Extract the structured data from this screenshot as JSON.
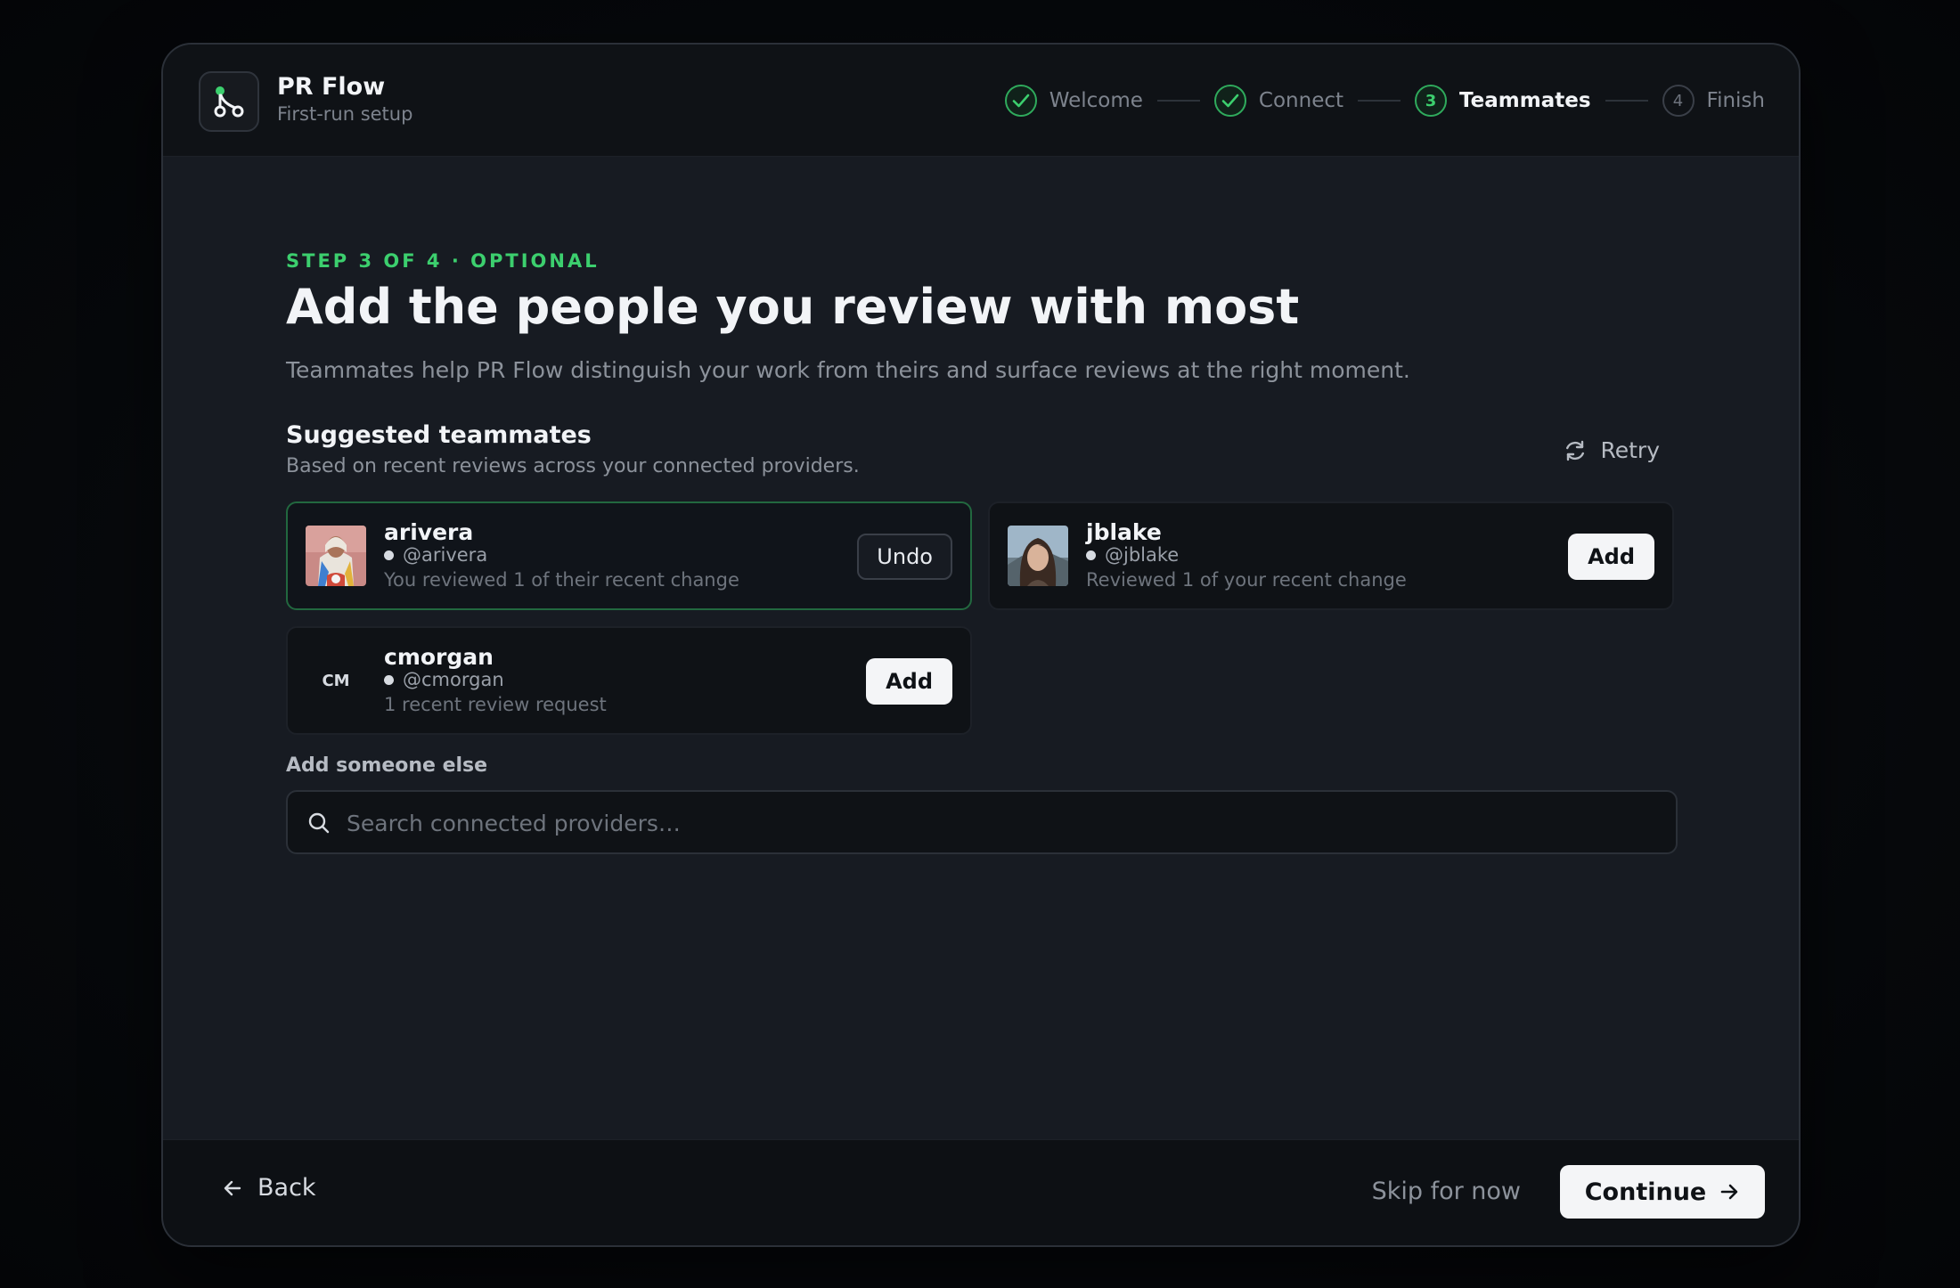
{
  "app": {
    "name": "PR Flow",
    "subtitle": "First-run setup"
  },
  "stepper": {
    "steps": [
      {
        "label": "Welcome",
        "state": "done",
        "number": "1"
      },
      {
        "label": "Connect",
        "state": "done",
        "number": "2"
      },
      {
        "label": "Teammates",
        "state": "active",
        "number": "3"
      },
      {
        "label": "Finish",
        "state": "todo",
        "number": "4"
      }
    ]
  },
  "page": {
    "eyebrow": "STEP 3 OF 4 · OPTIONAL",
    "title": "Add the people you review with most",
    "description": "Teammates help PR Flow distinguish your work from theirs and surface reviews at the right moment."
  },
  "suggested": {
    "title": "Suggested teammates",
    "subtitle": "Based on recent reviews across your connected providers.",
    "retry_label": "Retry",
    "people": [
      {
        "name": "arivera",
        "handle": "@arivera",
        "meta": "You reviewed 1 of their recent change",
        "action": "Undo",
        "selected": true,
        "avatar": "photo"
      },
      {
        "name": "jblake",
        "handle": "@jblake",
        "meta": "Reviewed 1 of your recent change",
        "action": "Add",
        "selected": false,
        "avatar": "photo"
      },
      {
        "name": "cmorgan",
        "handle": "@cmorgan",
        "meta": "1 recent review request",
        "action": "Add",
        "selected": false,
        "avatar": "initials",
        "initials": "CM"
      }
    ]
  },
  "add_other": {
    "label": "Add someone else",
    "placeholder": "Search connected providers…",
    "value": ""
  },
  "footer": {
    "back_label": "Back",
    "skip_label": "Skip for now",
    "continue_label": "Continue"
  },
  "colors": {
    "accent": "#3ccf6e",
    "background": "#171b22",
    "panel": "#0f1216"
  },
  "icons": {
    "logo": "branch-merge-icon",
    "step_done": "check-icon",
    "retry": "refresh-icon",
    "search": "search-icon",
    "back": "arrow-left-icon",
    "continue": "arrow-right-icon"
  }
}
